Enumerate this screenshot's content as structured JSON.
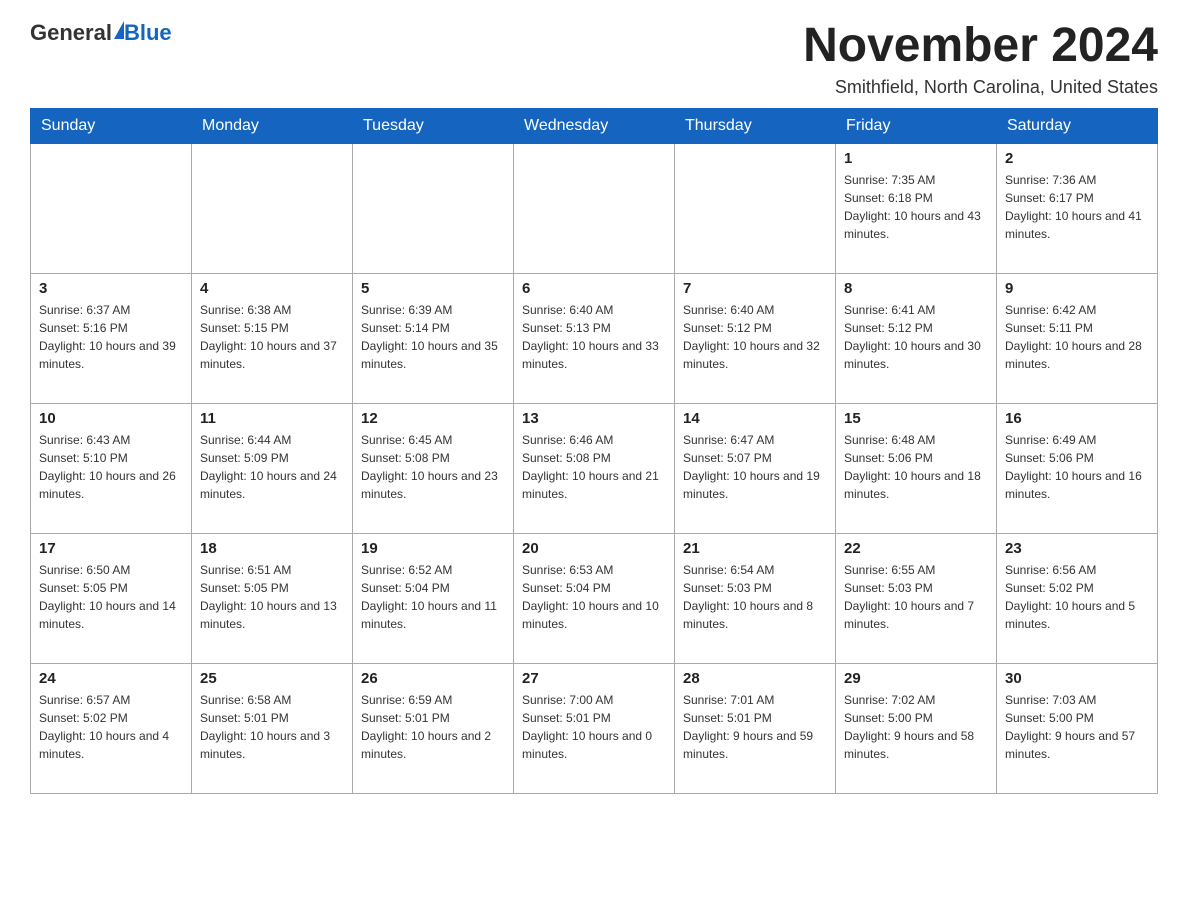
{
  "header": {
    "logo_general": "General",
    "logo_blue": "Blue",
    "month_title": "November 2024",
    "location": "Smithfield, North Carolina, United States"
  },
  "weekdays": [
    "Sunday",
    "Monday",
    "Tuesday",
    "Wednesday",
    "Thursday",
    "Friday",
    "Saturday"
  ],
  "weeks": [
    [
      {
        "day": "",
        "sunrise": "",
        "sunset": "",
        "daylight": ""
      },
      {
        "day": "",
        "sunrise": "",
        "sunset": "",
        "daylight": ""
      },
      {
        "day": "",
        "sunrise": "",
        "sunset": "",
        "daylight": ""
      },
      {
        "day": "",
        "sunrise": "",
        "sunset": "",
        "daylight": ""
      },
      {
        "day": "",
        "sunrise": "",
        "sunset": "",
        "daylight": ""
      },
      {
        "day": "1",
        "sunrise": "Sunrise: 7:35 AM",
        "sunset": "Sunset: 6:18 PM",
        "daylight": "Daylight: 10 hours and 43 minutes."
      },
      {
        "day": "2",
        "sunrise": "Sunrise: 7:36 AM",
        "sunset": "Sunset: 6:17 PM",
        "daylight": "Daylight: 10 hours and 41 minutes."
      }
    ],
    [
      {
        "day": "3",
        "sunrise": "Sunrise: 6:37 AM",
        "sunset": "Sunset: 5:16 PM",
        "daylight": "Daylight: 10 hours and 39 minutes."
      },
      {
        "day": "4",
        "sunrise": "Sunrise: 6:38 AM",
        "sunset": "Sunset: 5:15 PM",
        "daylight": "Daylight: 10 hours and 37 minutes."
      },
      {
        "day": "5",
        "sunrise": "Sunrise: 6:39 AM",
        "sunset": "Sunset: 5:14 PM",
        "daylight": "Daylight: 10 hours and 35 minutes."
      },
      {
        "day": "6",
        "sunrise": "Sunrise: 6:40 AM",
        "sunset": "Sunset: 5:13 PM",
        "daylight": "Daylight: 10 hours and 33 minutes."
      },
      {
        "day": "7",
        "sunrise": "Sunrise: 6:40 AM",
        "sunset": "Sunset: 5:12 PM",
        "daylight": "Daylight: 10 hours and 32 minutes."
      },
      {
        "day": "8",
        "sunrise": "Sunrise: 6:41 AM",
        "sunset": "Sunset: 5:12 PM",
        "daylight": "Daylight: 10 hours and 30 minutes."
      },
      {
        "day": "9",
        "sunrise": "Sunrise: 6:42 AM",
        "sunset": "Sunset: 5:11 PM",
        "daylight": "Daylight: 10 hours and 28 minutes."
      }
    ],
    [
      {
        "day": "10",
        "sunrise": "Sunrise: 6:43 AM",
        "sunset": "Sunset: 5:10 PM",
        "daylight": "Daylight: 10 hours and 26 minutes."
      },
      {
        "day": "11",
        "sunrise": "Sunrise: 6:44 AM",
        "sunset": "Sunset: 5:09 PM",
        "daylight": "Daylight: 10 hours and 24 minutes."
      },
      {
        "day": "12",
        "sunrise": "Sunrise: 6:45 AM",
        "sunset": "Sunset: 5:08 PM",
        "daylight": "Daylight: 10 hours and 23 minutes."
      },
      {
        "day": "13",
        "sunrise": "Sunrise: 6:46 AM",
        "sunset": "Sunset: 5:08 PM",
        "daylight": "Daylight: 10 hours and 21 minutes."
      },
      {
        "day": "14",
        "sunrise": "Sunrise: 6:47 AM",
        "sunset": "Sunset: 5:07 PM",
        "daylight": "Daylight: 10 hours and 19 minutes."
      },
      {
        "day": "15",
        "sunrise": "Sunrise: 6:48 AM",
        "sunset": "Sunset: 5:06 PM",
        "daylight": "Daylight: 10 hours and 18 minutes."
      },
      {
        "day": "16",
        "sunrise": "Sunrise: 6:49 AM",
        "sunset": "Sunset: 5:06 PM",
        "daylight": "Daylight: 10 hours and 16 minutes."
      }
    ],
    [
      {
        "day": "17",
        "sunrise": "Sunrise: 6:50 AM",
        "sunset": "Sunset: 5:05 PM",
        "daylight": "Daylight: 10 hours and 14 minutes."
      },
      {
        "day": "18",
        "sunrise": "Sunrise: 6:51 AM",
        "sunset": "Sunset: 5:05 PM",
        "daylight": "Daylight: 10 hours and 13 minutes."
      },
      {
        "day": "19",
        "sunrise": "Sunrise: 6:52 AM",
        "sunset": "Sunset: 5:04 PM",
        "daylight": "Daylight: 10 hours and 11 minutes."
      },
      {
        "day": "20",
        "sunrise": "Sunrise: 6:53 AM",
        "sunset": "Sunset: 5:04 PM",
        "daylight": "Daylight: 10 hours and 10 minutes."
      },
      {
        "day": "21",
        "sunrise": "Sunrise: 6:54 AM",
        "sunset": "Sunset: 5:03 PM",
        "daylight": "Daylight: 10 hours and 8 minutes."
      },
      {
        "day": "22",
        "sunrise": "Sunrise: 6:55 AM",
        "sunset": "Sunset: 5:03 PM",
        "daylight": "Daylight: 10 hours and 7 minutes."
      },
      {
        "day": "23",
        "sunrise": "Sunrise: 6:56 AM",
        "sunset": "Sunset: 5:02 PM",
        "daylight": "Daylight: 10 hours and 5 minutes."
      }
    ],
    [
      {
        "day": "24",
        "sunrise": "Sunrise: 6:57 AM",
        "sunset": "Sunset: 5:02 PM",
        "daylight": "Daylight: 10 hours and 4 minutes."
      },
      {
        "day": "25",
        "sunrise": "Sunrise: 6:58 AM",
        "sunset": "Sunset: 5:01 PM",
        "daylight": "Daylight: 10 hours and 3 minutes."
      },
      {
        "day": "26",
        "sunrise": "Sunrise: 6:59 AM",
        "sunset": "Sunset: 5:01 PM",
        "daylight": "Daylight: 10 hours and 2 minutes."
      },
      {
        "day": "27",
        "sunrise": "Sunrise: 7:00 AM",
        "sunset": "Sunset: 5:01 PM",
        "daylight": "Daylight: 10 hours and 0 minutes."
      },
      {
        "day": "28",
        "sunrise": "Sunrise: 7:01 AM",
        "sunset": "Sunset: 5:01 PM",
        "daylight": "Daylight: 9 hours and 59 minutes."
      },
      {
        "day": "29",
        "sunrise": "Sunrise: 7:02 AM",
        "sunset": "Sunset: 5:00 PM",
        "daylight": "Daylight: 9 hours and 58 minutes."
      },
      {
        "day": "30",
        "sunrise": "Sunrise: 7:03 AM",
        "sunset": "Sunset: 5:00 PM",
        "daylight": "Daylight: 9 hours and 57 minutes."
      }
    ]
  ]
}
